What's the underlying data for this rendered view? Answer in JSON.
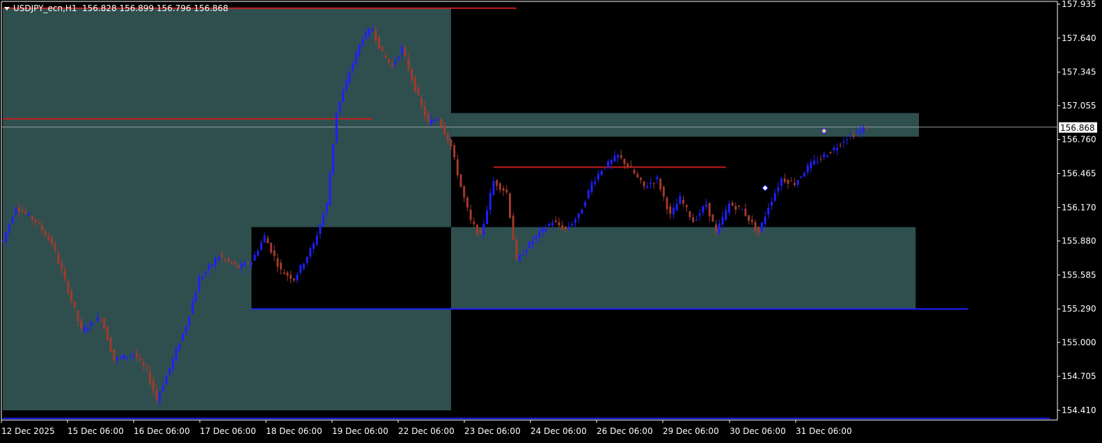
{
  "window": {
    "symbol": "USDJPY_ecn",
    "timeframe": "H1",
    "ohlc": "156.828 156.899 156.796 156.868",
    "menu_icon": "triangle-down-icon"
  },
  "colors": {
    "background": "#000000",
    "frame": "#ffffff",
    "bull_candle": "#1f1fff",
    "bear_candle": "#a33a2c",
    "zone_fill": "#2f4f4f",
    "level_red": "#c41e1e",
    "level_blue": "#1f1fff",
    "current_price_line": "#9aa0a0",
    "current_price_box": "#ffffff"
  },
  "price_axis": {
    "ticks": [
      "157.935",
      "157.640",
      "157.345",
      "157.055",
      "156.760",
      "156.465",
      "156.170",
      "155.880",
      "155.585",
      "155.290",
      "155.000",
      "154.705",
      "154.410"
    ],
    "current_price": "156.868"
  },
  "time_axis": {
    "ticks": [
      "12 Dec 2025",
      "15 Dec 06:00",
      "16 Dec 06:00",
      "17 Dec 06:00",
      "18 Dec 06:00",
      "19 Dec 06:00",
      "22 Dec 06:00",
      "23 Dec 06:00",
      "24 Dec 06:00",
      "26 Dec 06:00",
      "29 Dec 06:00",
      "30 Dec 06:00",
      "31 Dec 06:00"
    ]
  },
  "chart_data": {
    "type": "candlestick",
    "instrument": "USDJPY_ecn",
    "timeframe": "H1",
    "ylim": [
      154.35,
      157.96
    ],
    "last_ohlc": {
      "open": 156.828,
      "high": 156.899,
      "low": 156.796,
      "close": 156.868
    },
    "series": [
      {
        "x_from": 0,
        "x_to": 20,
        "points": [
          [
            0,
            155.88
          ],
          [
            4,
            156.18
          ],
          [
            10,
            156.05
          ],
          [
            15,
            155.86
          ],
          [
            20,
            155.45
          ]
        ]
      },
      {
        "x_from": 20,
        "x_to": 44,
        "points": [
          [
            20,
            155.45
          ],
          [
            24,
            155.1
          ],
          [
            30,
            155.22
          ],
          [
            34,
            154.85
          ],
          [
            40,
            154.9
          ],
          [
            44,
            154.75
          ]
        ]
      },
      {
        "x_from": 44,
        "x_to": 66,
        "points": [
          [
            44,
            154.75
          ],
          [
            47,
            154.5
          ],
          [
            52,
            154.85
          ],
          [
            56,
            155.15
          ],
          [
            60,
            155.55
          ],
          [
            66,
            155.75
          ]
        ]
      },
      {
        "x_from": 66,
        "x_to": 89,
        "points": [
          [
            66,
            155.75
          ],
          [
            72,
            155.65
          ],
          [
            76,
            155.7
          ],
          [
            80,
            155.92
          ],
          [
            85,
            155.62
          ],
          [
            89,
            155.55
          ]
        ]
      },
      {
        "x_from": 89,
        "x_to": 113,
        "points": [
          [
            89,
            155.55
          ],
          [
            95,
            155.85
          ],
          [
            99,
            156.2
          ],
          [
            102,
            157.0
          ],
          [
            106,
            157.35
          ],
          [
            110,
            157.65
          ],
          [
            113,
            157.72
          ]
        ]
      },
      {
        "x_from": 113,
        "x_to": 137,
        "points": [
          [
            113,
            157.72
          ],
          [
            116,
            157.5
          ],
          [
            119,
            157.4
          ],
          [
            122,
            157.55
          ],
          [
            126,
            157.2
          ],
          [
            130,
            156.9
          ],
          [
            133,
            156.95
          ],
          [
            137,
            156.7
          ]
        ]
      },
      {
        "x_from": 137,
        "x_to": 160,
        "points": [
          [
            137,
            156.7
          ],
          [
            140,
            156.35
          ],
          [
            143,
            156.05
          ],
          [
            146,
            155.92
          ],
          [
            150,
            156.4
          ],
          [
            154,
            156.3
          ],
          [
            157,
            155.7
          ],
          [
            160,
            155.82
          ]
        ]
      },
      {
        "x_from": 160,
        "x_to": 183,
        "points": [
          [
            160,
            155.82
          ],
          [
            164,
            155.95
          ],
          [
            168,
            156.05
          ],
          [
            172,
            155.98
          ],
          [
            176,
            156.1
          ],
          [
            180,
            156.38
          ],
          [
            183,
            156.5
          ]
        ]
      },
      {
        "x_from": 183,
        "x_to": 207,
        "points": [
          [
            183,
            156.5
          ],
          [
            188,
            156.62
          ],
          [
            192,
            156.5
          ],
          [
            196,
            156.35
          ],
          [
            200,
            156.42
          ],
          [
            204,
            156.1
          ],
          [
            207,
            156.25
          ]
        ]
      },
      {
        "x_from": 207,
        "x_to": 231,
        "points": [
          [
            207,
            156.25
          ],
          [
            211,
            156.05
          ],
          [
            215,
            156.2
          ],
          [
            218,
            155.95
          ],
          [
            222,
            156.2
          ],
          [
            226,
            156.15
          ],
          [
            231,
            155.95
          ]
        ]
      },
      {
        "x_from": 231,
        "x_to": 254,
        "points": [
          [
            231,
            155.95
          ],
          [
            234,
            156.18
          ],
          [
            238,
            156.42
          ],
          [
            242,
            156.38
          ],
          [
            246,
            156.52
          ],
          [
            250,
            156.6
          ],
          [
            254,
            156.68
          ]
        ]
      },
      {
        "x_from": 254,
        "x_to": 264,
        "points": [
          [
            254,
            156.68
          ],
          [
            258,
            156.78
          ],
          [
            261,
            156.82
          ],
          [
            264,
            156.868
          ]
        ]
      }
    ],
    "zones": [
      {
        "x_from": 0,
        "x_to": 137,
        "y_from": 154.41,
        "y_to": 157.9
      },
      {
        "x_from": 137,
        "x_to": 280,
        "y_from": 156.785,
        "y_to": 156.99
      },
      {
        "x_from": 137,
        "x_to": 279,
        "y_from": 155.29,
        "y_to": 156.0
      },
      {
        "x_from": 76,
        "x_to": 137,
        "y_from": 155.29,
        "y_to": 156.0
      }
    ],
    "levels": [
      {
        "x_from": 0,
        "x_to": 157,
        "price": 157.9,
        "color": "red"
      },
      {
        "x_from": 0,
        "x_to": 113,
        "price": 156.94,
        "color": "red"
      },
      {
        "x_from": 150,
        "x_to": 221,
        "price": 156.52,
        "color": "red"
      },
      {
        "x_from": 76,
        "x_to": 295,
        "price": 155.29,
        "color": "blue"
      },
      {
        "x_from": 0,
        "x_to": 320,
        "price": 154.34,
        "color": "blue"
      }
    ],
    "markers": [
      {
        "x": 233,
        "price": 156.34,
        "shape": "diamond-white"
      },
      {
        "x": 251,
        "price": 156.835,
        "shape": "diamond-gold"
      }
    ]
  }
}
